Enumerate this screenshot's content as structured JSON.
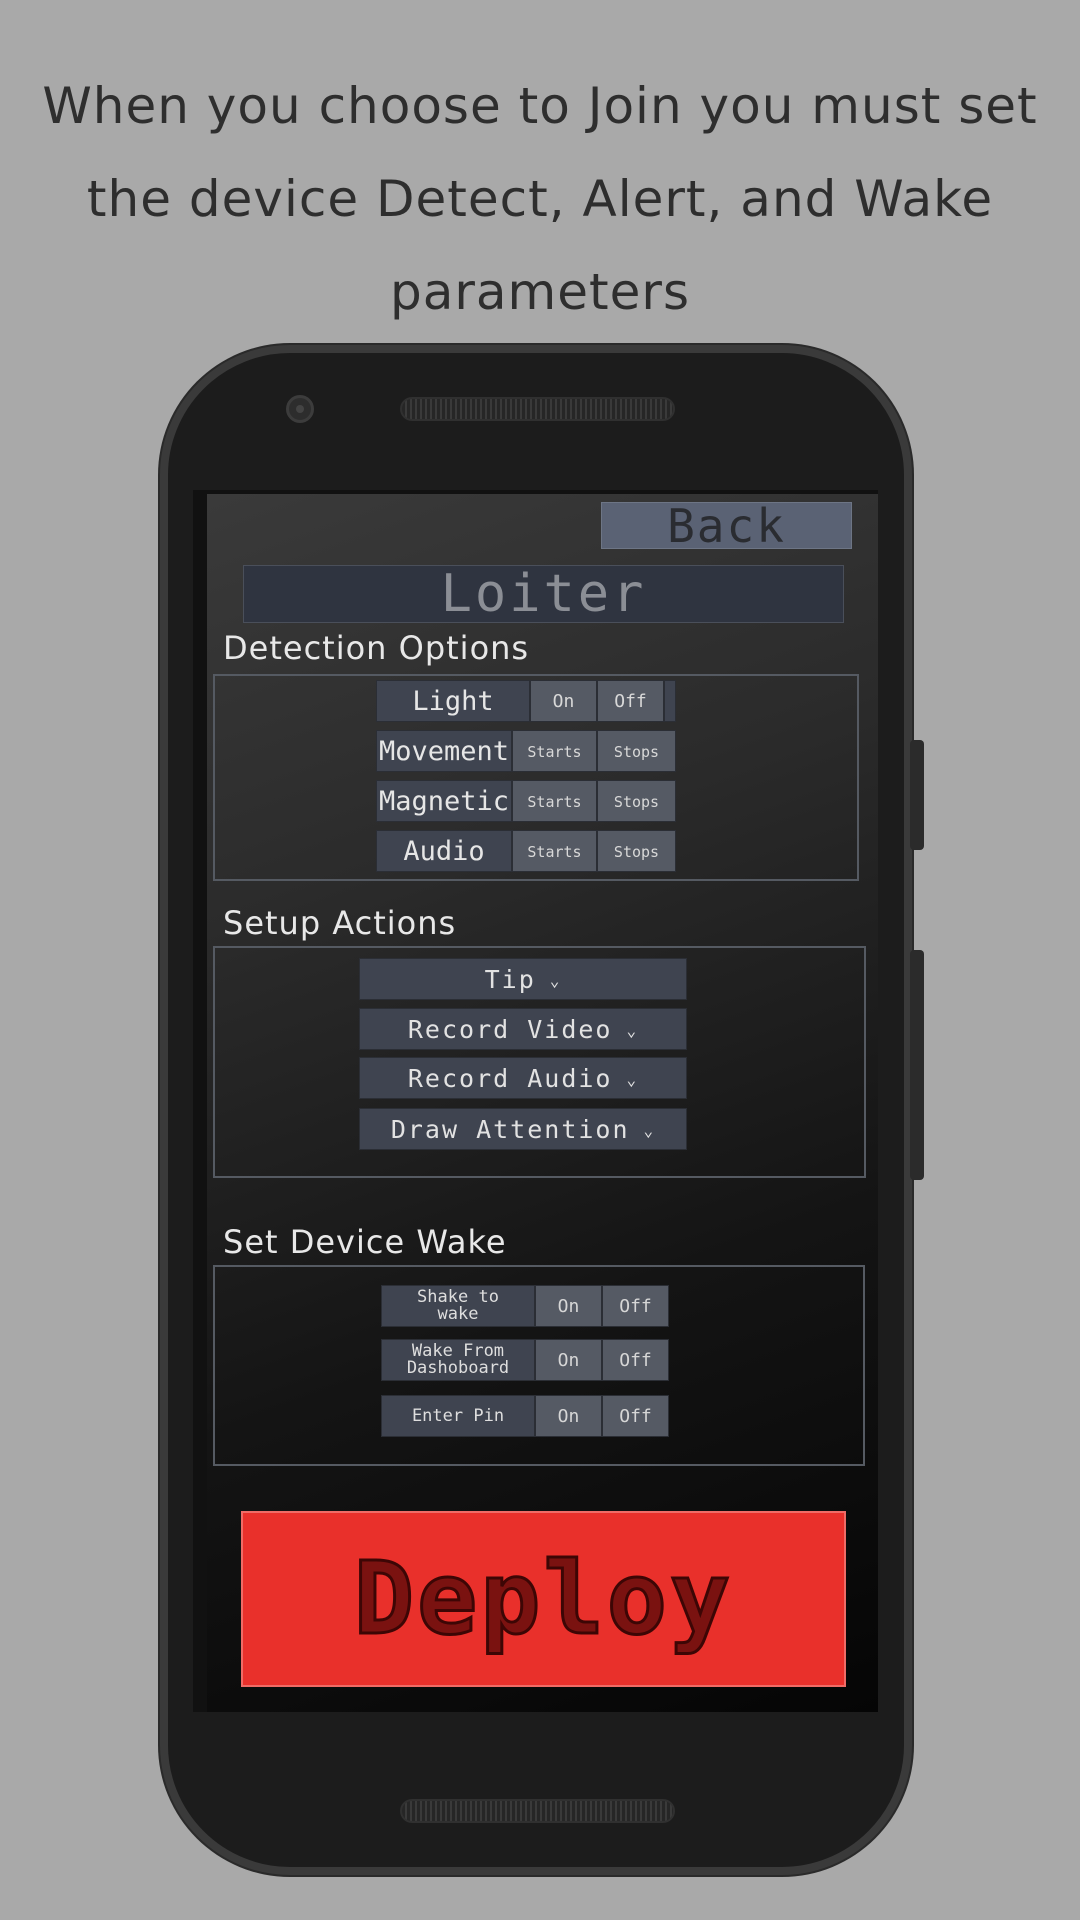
{
  "caption": {
    "line1": "When you choose to Join you must set",
    "line2": "the device Detect, Alert, and Wake",
    "line3": "parameters"
  },
  "app": {
    "back_label": "Back",
    "title": "Loiter",
    "deploy_label": "Deploy"
  },
  "detection": {
    "heading": "Detection Options",
    "rows": [
      {
        "label": "Light",
        "opt1": "On",
        "opt2": "Off"
      },
      {
        "label": "Movement",
        "opt1": "Starts",
        "opt2": "Stops"
      },
      {
        "label": "Magnetic",
        "opt1": "Starts",
        "opt2": "Stops"
      },
      {
        "label": "Audio",
        "opt1": "Starts",
        "opt2": "Stops"
      }
    ]
  },
  "setup": {
    "heading": "Setup Actions",
    "dropdowns": [
      "Tip",
      "Record Video",
      "Record Audio",
      "Draw Attention"
    ],
    "chevron": "⌄"
  },
  "wake": {
    "heading": "Set Device Wake",
    "rows": [
      {
        "label_line1": "Shake to",
        "label_line2": "wake",
        "opt1": "On",
        "opt2": "Off"
      },
      {
        "label_line1": "Wake From",
        "label_line2": "Dashoboard",
        "opt1": "On",
        "opt2": "Off"
      },
      {
        "label_line1": "Enter Pin",
        "label_line2": "",
        "opt1": "On",
        "opt2": "Off"
      }
    ]
  },
  "colors": {
    "background": "#a9a9a9",
    "deploy": "#e9302b",
    "button": "#3f4450",
    "option": "#555a64"
  }
}
